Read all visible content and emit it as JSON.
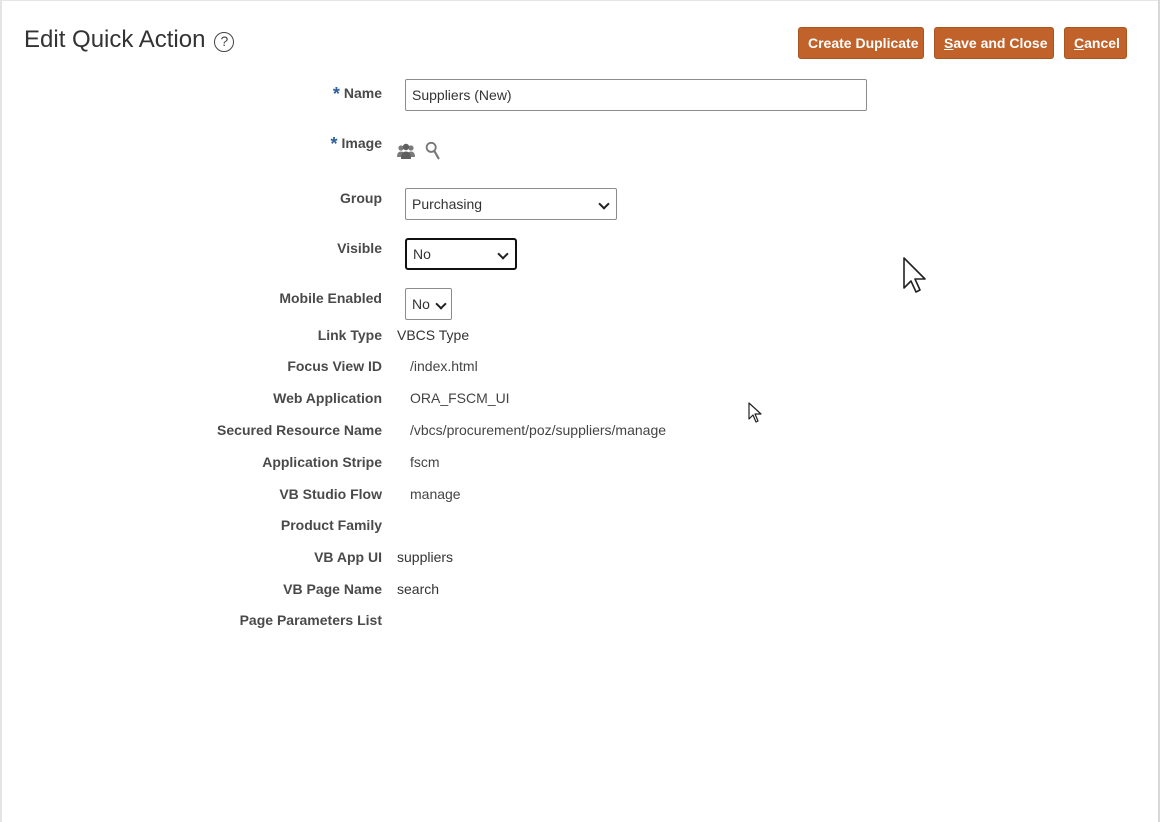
{
  "header": {
    "title": "Edit Quick Action",
    "help_icon": "question-circle-icon",
    "create_duplicate_label": "Create Duplicate",
    "save_and_close_label_first": "S",
    "save_and_close_label_rest": "ave and Close",
    "cancel_label_first": "C",
    "cancel_label_rest": "ancel"
  },
  "form": {
    "name": {
      "label": "Name",
      "required": "*",
      "value": "Suppliers (New)"
    },
    "image": {
      "label": "Image",
      "required": "*",
      "icons": [
        "people-icon",
        "search-icon"
      ]
    },
    "group": {
      "label": "Group",
      "selected": "Purchasing"
    },
    "visible": {
      "label": "Visible",
      "selected": "No"
    },
    "mobile_enabled": {
      "label": "Mobile Enabled",
      "selected": "No"
    },
    "link_type": {
      "label": "Link Type",
      "value": "VBCS Type"
    },
    "focus_view_id": {
      "label": "Focus View ID",
      "value": "/index.html"
    },
    "web_application": {
      "label": "Web Application",
      "value": "ORA_FSCM_UI"
    },
    "secured_resource_name": {
      "label": "Secured Resource Name",
      "value": "/vbcs/procurement/poz/suppliers/manage"
    },
    "application_stripe": {
      "label": "Application Stripe",
      "value": "fscm"
    },
    "vb_studio_flow": {
      "label": "VB Studio Flow",
      "value": "manage"
    },
    "product_family": {
      "label": "Product Family",
      "value": ""
    },
    "vb_app_ui": {
      "label": "VB App UI",
      "value": "suppliers"
    },
    "vb_page_name": {
      "label": "VB Page Name",
      "value": "search"
    },
    "page_parameters_list": {
      "label": "Page Parameters List",
      "value": ""
    }
  },
  "colors": {
    "button_bg": "#c0622a",
    "required_star": "#2a5e9c"
  }
}
